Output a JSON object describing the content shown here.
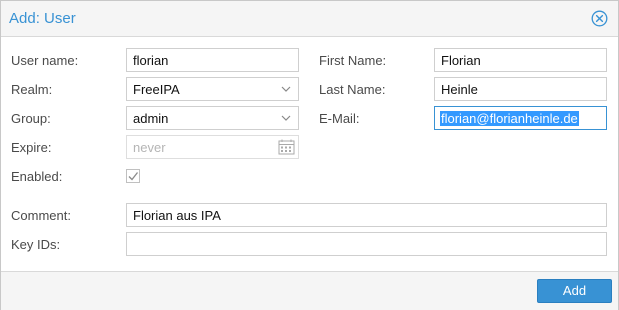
{
  "dialog": {
    "title": "Add: User",
    "close_icon": "close-circle-icon"
  },
  "form": {
    "username": {
      "label": "User name:",
      "value": "florian"
    },
    "realm": {
      "label": "Realm:",
      "value": "FreeIPA"
    },
    "group": {
      "label": "Group:",
      "value": "admin"
    },
    "expire": {
      "label": "Expire:",
      "placeholder": "never",
      "icon": "calendar-icon"
    },
    "enabled": {
      "label": "Enabled:",
      "checked": true
    },
    "firstname": {
      "label": "First Name:",
      "value": "Florian"
    },
    "lastname": {
      "label": "Last Name:",
      "value": "Heinle"
    },
    "email": {
      "label": "E-Mail:",
      "value": "florian@florianheinle.de"
    },
    "comment": {
      "label": "Comment:",
      "value": "Florian aus IPA"
    },
    "keyids": {
      "label": "Key IDs:",
      "value": ""
    }
  },
  "footer": {
    "add_label": "Add"
  },
  "colors": {
    "accent": "#3892d4",
    "selection": "#3399ff"
  }
}
